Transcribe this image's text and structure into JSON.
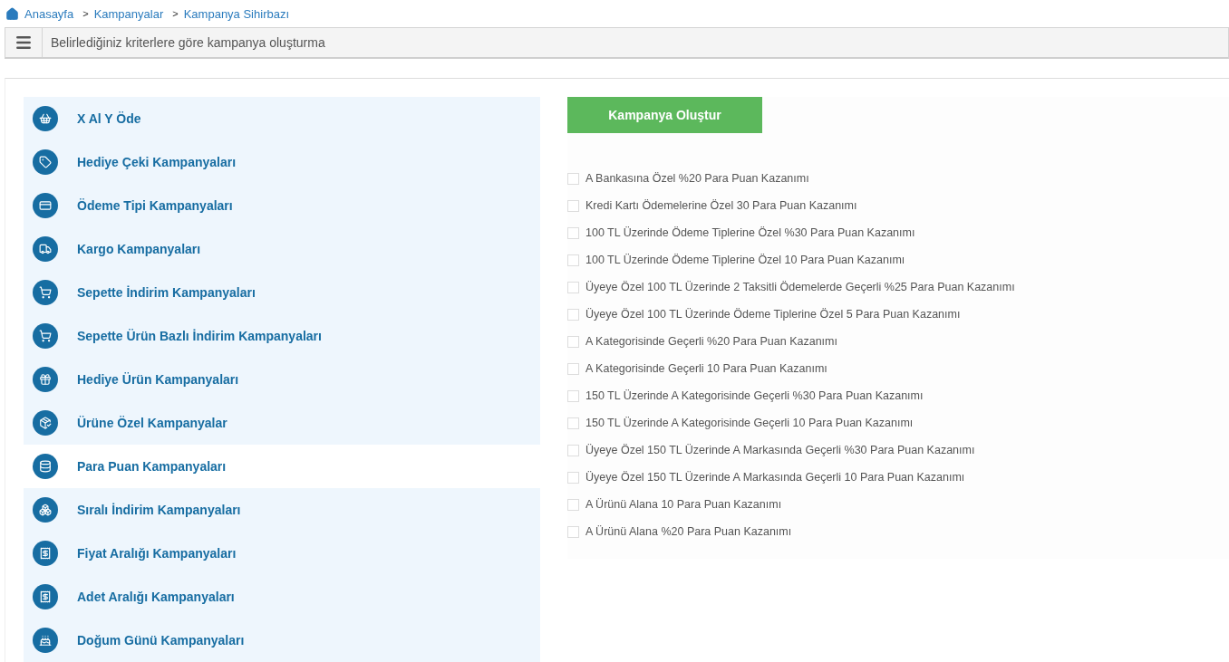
{
  "breadcrumb": [
    {
      "label": "Anasayfa"
    },
    {
      "separator": ">",
      "label": "Kampanyalar"
    },
    {
      "separator": ">",
      "label": "Kampanya Sihirbazı"
    }
  ],
  "header": {
    "title": "Belirlediğiniz kriterlere göre kampanya oluşturma"
  },
  "sidebar": {
    "items": [
      {
        "label": "X Al Y Öde",
        "selected": false
      },
      {
        "label": "Hediye Çeki Kampanyaları",
        "selected": false
      },
      {
        "label": "Ödeme Tipi Kampanyaları",
        "selected": false
      },
      {
        "label": "Kargo Kampanyaları",
        "selected": false
      },
      {
        "label": "Sepette İndirim Kampanyaları",
        "selected": false
      },
      {
        "label": "Sepette Ürün Bazlı İndirim Kampanyaları",
        "selected": false
      },
      {
        "label": "Hediye Ürün Kampanyaları",
        "selected": false
      },
      {
        "label": "Ürüne Özel Kampanyalar",
        "selected": false
      },
      {
        "label": "Para Puan Kampanyaları",
        "selected": true
      },
      {
        "label": "Sıralı İndirim Kampanyaları",
        "selected": false
      },
      {
        "label": "Fiyat Aralığı Kampanyaları",
        "selected": false
      },
      {
        "label": "Adet Aralığı Kampanyaları",
        "selected": false
      },
      {
        "label": "Doğum Günü Kampanyaları",
        "selected": false
      }
    ]
  },
  "create_button": "Kampanya Oluştur",
  "options": [
    {
      "label": "A Bankasına Özel %20 Para Puan Kazanımı",
      "checked": false
    },
    {
      "label": "Kredi Kartı Ödemelerine Özel 30 Para Puan Kazanımı",
      "checked": false
    },
    {
      "label": "100 TL Üzerinde Ödeme Tiplerine Özel %30 Para Puan Kazanımı",
      "checked": false
    },
    {
      "label": "100 TL Üzerinde Ödeme Tiplerine Özel 10 Para Puan Kazanımı",
      "checked": false
    },
    {
      "label": "Üyeye Özel 100 TL Üzerinde 2 Taksitli Ödemelerde Geçerli %25 Para Puan Kazanımı",
      "checked": false
    },
    {
      "label": "Üyeye Özel 100 TL Üzerinde Ödeme Tiplerine Özel 5 Para Puan Kazanımı",
      "checked": false
    },
    {
      "label": "A Kategorisinde Geçerli %20 Para Puan Kazanımı",
      "checked": false
    },
    {
      "label": "A Kategorisinde Geçerli 10 Para Puan Kazanımı",
      "checked": false
    },
    {
      "label": "150 TL Üzerinde A Kategorisinde Geçerli %30 Para Puan Kazanımı",
      "checked": false
    },
    {
      "label": "150 TL Üzerinde A Kategorisinde Geçerli 10 Para Puan Kazanımı",
      "checked": false
    },
    {
      "label": "Üyeye Özel 150 TL Üzerinde A Markasında Geçerli %30 Para Puan Kazanımı",
      "checked": false
    },
    {
      "label": "Üyeye Özel 150 TL Üzerinde A Markasında Geçerli 10 Para Puan Kazanımı",
      "checked": false
    },
    {
      "label": "A Ürünü Alana 10 Para Puan Kazanımı",
      "checked": false
    },
    {
      "label": "A Ürünü Alana %20 Para Puan Kazanımı",
      "checked": false
    }
  ]
}
